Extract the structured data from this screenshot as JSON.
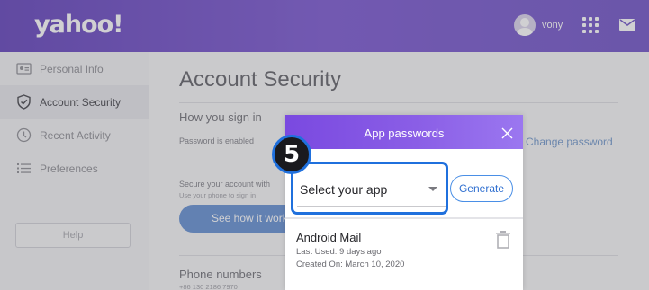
{
  "header": {
    "logo": "yahoo!",
    "username": "vony",
    "icons": [
      "avatar",
      "apps-grid-icon",
      "mail-icon"
    ]
  },
  "sidebar": {
    "items": [
      {
        "label": "Personal Info",
        "icon": "person-card-icon",
        "active": false
      },
      {
        "label": "Account Security",
        "icon": "shield-icon",
        "active": true
      },
      {
        "label": "Recent Activity",
        "icon": "clock-icon",
        "active": false
      },
      {
        "label": "Preferences",
        "icon": "list-icon",
        "active": false
      }
    ],
    "help_label": "Help"
  },
  "main": {
    "title": "Account Security",
    "signin_section": "How you sign in",
    "password_status": "Password is enabled",
    "change_password": "Change password",
    "secure_text": "Secure your account with",
    "phone_text": "Use your phone to sign in",
    "see_button": "See how it work",
    "phone_section": "Phone numbers",
    "phone_number": "+86 130 2186 7970"
  },
  "modal": {
    "title": "App passwords",
    "select_value": "Select your app",
    "generate_label": "Generate",
    "entry": {
      "name": "Android Mail",
      "last_used": "Last Used: 9 days ago",
      "created": "Created On: March 10, 2020"
    }
  },
  "callout": {
    "step": "5",
    "color": "#1f70dd"
  }
}
